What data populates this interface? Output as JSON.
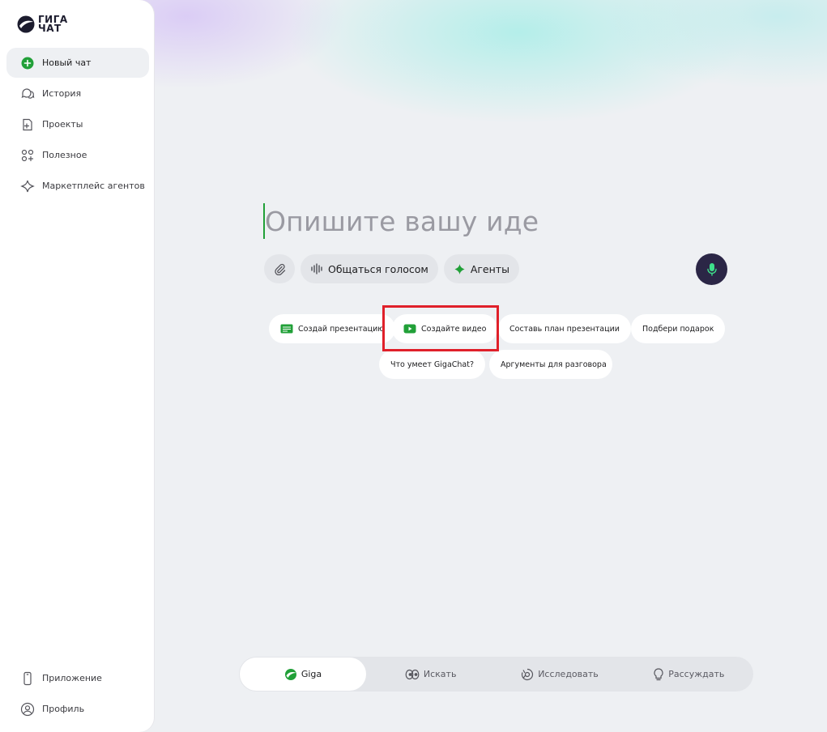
{
  "brand": {
    "line1": "ГИГА",
    "line2": "ЧАТ"
  },
  "sidebar": {
    "items": [
      {
        "label": "Новый чат",
        "icon": "new-chat-plus-icon"
      },
      {
        "label": "История",
        "icon": "chat-bubbles-icon"
      },
      {
        "label": "Проекты",
        "icon": "project-file-icon"
      },
      {
        "label": "Полезное",
        "icon": "grid-shapes-icon"
      },
      {
        "label": "Маркетплейс агентов",
        "icon": "sparkle-icon"
      }
    ],
    "bottom": [
      {
        "label": "Приложение",
        "icon": "phone-icon"
      },
      {
        "label": "Профиль",
        "icon": "profile-icon"
      }
    ]
  },
  "prompt": {
    "text": "Опишите вашу иде"
  },
  "tools": {
    "attach_icon": "paperclip-icon",
    "voice_label": "Общаться голосом",
    "agents_label": "Агенты",
    "mic_icon": "microphone-icon"
  },
  "suggestions": [
    {
      "label": "Создай презентацию",
      "icon": "presentation-icon"
    },
    {
      "label": "Создайте видео",
      "icon": "video-play-icon"
    },
    {
      "label": "Составь план презентации"
    },
    {
      "label": "Подбери подарок"
    },
    {
      "label": "Что умеет GigaChat?"
    },
    {
      "label": "Аргументы для разговора"
    }
  ],
  "modes": [
    {
      "label": "Giga",
      "icon": "giga-logo-icon",
      "active": true
    },
    {
      "label": "Искать",
      "icon": "search-eyes-icon"
    },
    {
      "label": "Исследовать",
      "icon": "research-icon"
    },
    {
      "label": "Рассуждать",
      "icon": "lightbulb-icon"
    }
  ],
  "colors": {
    "accent": "#21a038",
    "mic_bg": "#2b2646",
    "highlight": "#e0202a"
  }
}
